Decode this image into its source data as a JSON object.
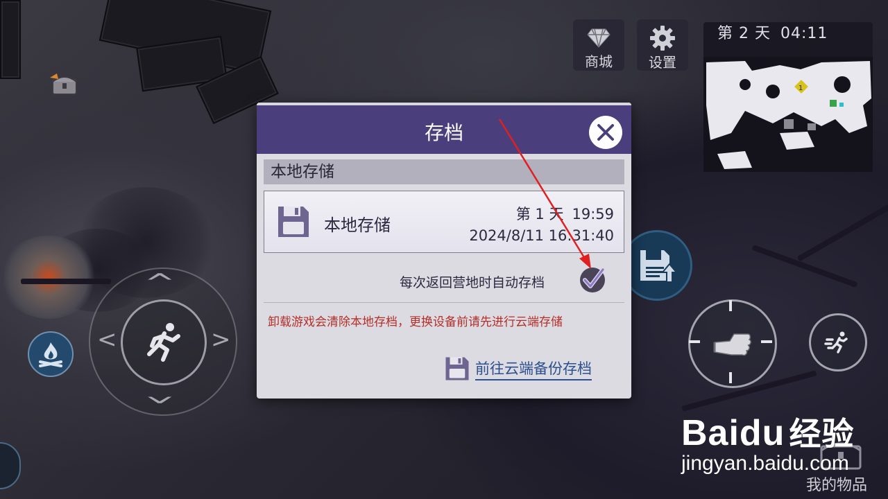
{
  "hud": {
    "shop_label": "商城",
    "settings_label": "设置",
    "minimap": {
      "day": "第 2 天",
      "time": "04:11"
    }
  },
  "dialog": {
    "title": "存档",
    "section_title": "本地存储",
    "slot": {
      "name": "本地存储",
      "day": "第 1 天",
      "time": "19:59",
      "date": "2024/8/11 16:31:40"
    },
    "autosave_label": "每次返回营地时自动存档",
    "autosave_checked": true,
    "warning": "卸载游戏会清除本地存档，更换设备前请先进行云端存储",
    "cloud_link": "前往云端备份存档"
  },
  "inventory_label": "我的物品",
  "watermark": {
    "brand": "Baidu",
    "brand_suffix": "经验",
    "url": "jingyan.baidu.com"
  },
  "colors": {
    "dialog_header": "#4a3f7c",
    "warning": "#b52f28",
    "link": "#2b4f8f",
    "annotation_arrow": "#e02020"
  },
  "icons": [
    "diamond-icon",
    "gear-icon",
    "run-icon",
    "campfire-icon",
    "save-upload-icon",
    "fist-icon",
    "sprint-icon",
    "floppy-icon",
    "check-icon",
    "close-icon",
    "treasure-chest-icon"
  ]
}
